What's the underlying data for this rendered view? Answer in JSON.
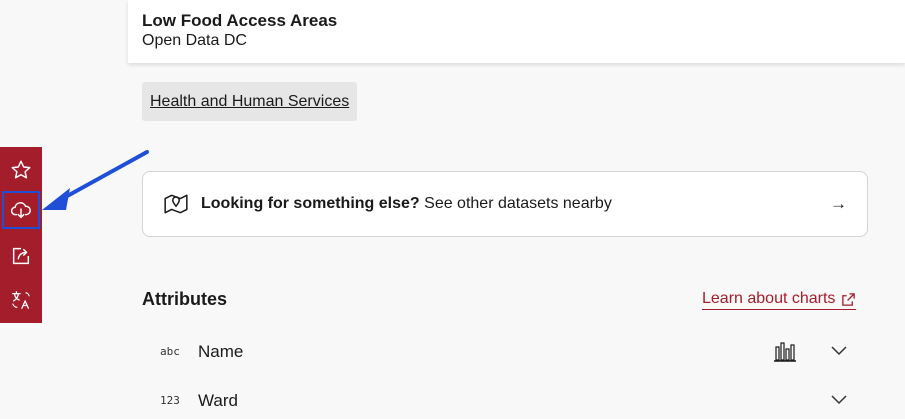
{
  "header": {
    "title": "Low Food Access Areas",
    "subtitle": "Open Data DC"
  },
  "category_tag": "Health and Human Services",
  "sidebar": {
    "color": "#a31d2b",
    "items": [
      {
        "icon": "star-icon"
      },
      {
        "icon": "cloud-download-icon",
        "highlighted": true
      },
      {
        "icon": "share-icon"
      },
      {
        "icon": "translate-icon"
      }
    ]
  },
  "banner": {
    "bold_text": "Looking for something else?",
    "text": "See other datasets nearby",
    "arrow": "→"
  },
  "attributes": {
    "title": "Attributes",
    "learn_link": "Learn about charts",
    "rows": [
      {
        "type": "abc",
        "name": "Name"
      },
      {
        "type": "123",
        "name": "Ward"
      }
    ]
  }
}
